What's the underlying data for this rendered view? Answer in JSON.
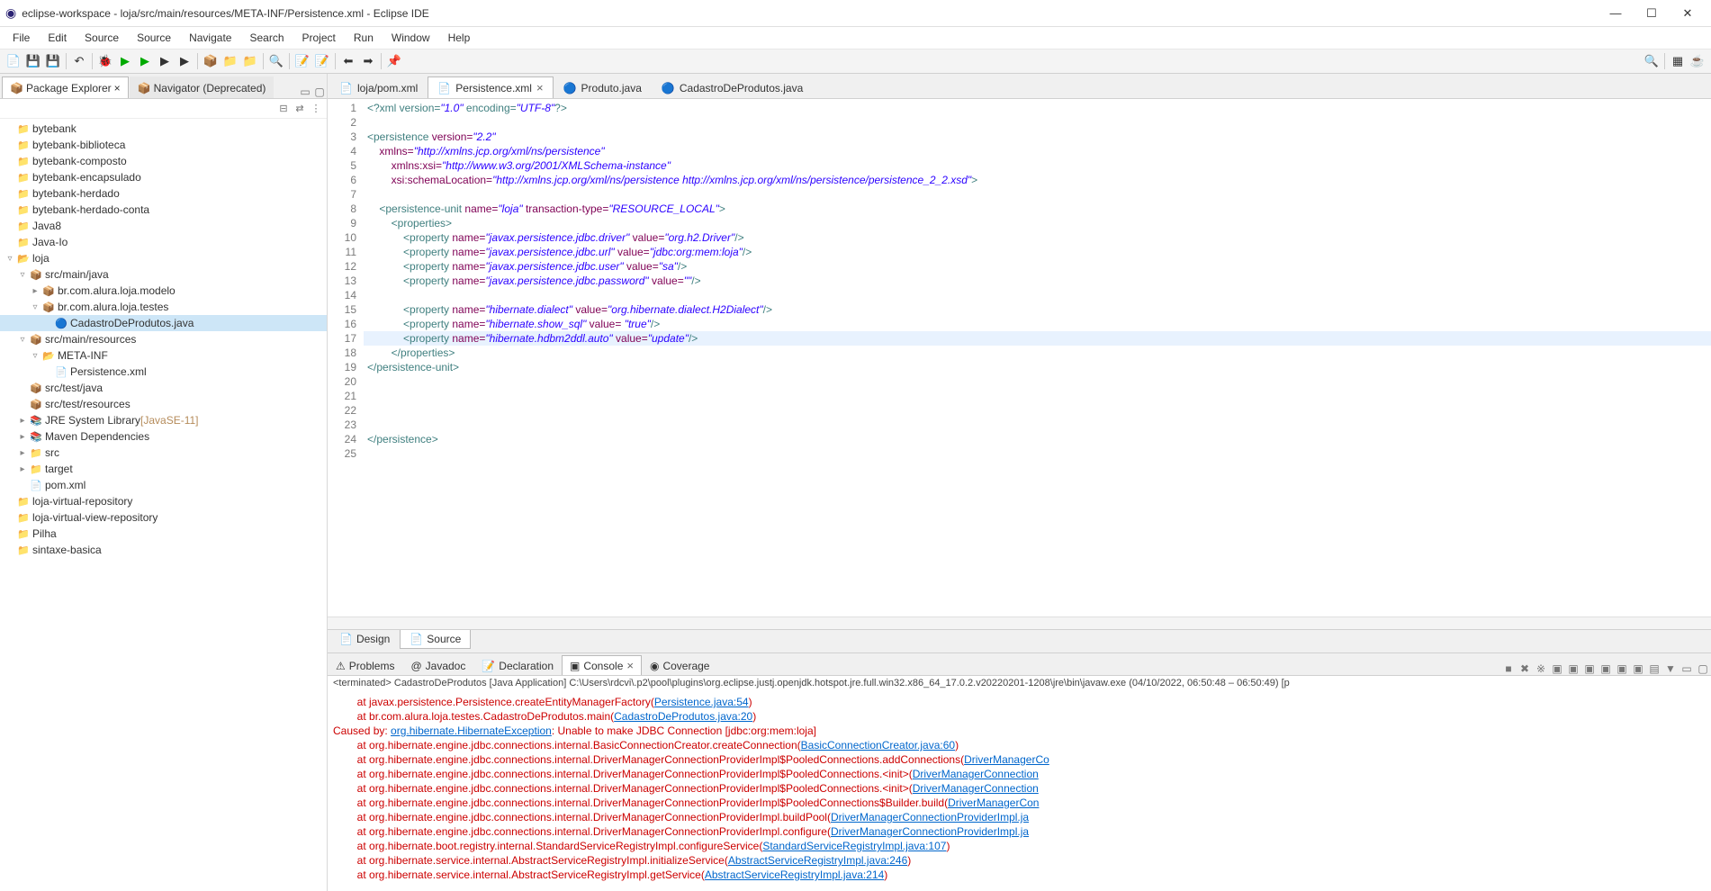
{
  "window_title": "eclipse-workspace - loja/src/main/resources/META-INF/Persistence.xml - Eclipse IDE",
  "menus": [
    "File",
    "Edit",
    "Source",
    "Source",
    "Navigate",
    "Search",
    "Project",
    "Run",
    "Window",
    "Help"
  ],
  "left_panel": {
    "tabs": [
      {
        "label": "Package Explorer",
        "active": true
      },
      {
        "label": "Navigator (Deprecated)",
        "active": false
      }
    ]
  },
  "projects": [
    {
      "label": "bytebank",
      "icon": "📁",
      "lv": 0,
      "tw": ""
    },
    {
      "label": "bytebank-biblioteca",
      "icon": "📁",
      "lv": 0,
      "tw": ""
    },
    {
      "label": "bytebank-composto",
      "icon": "📁",
      "lv": 0,
      "tw": ""
    },
    {
      "label": "bytebank-encapsulado",
      "icon": "📁",
      "lv": 0,
      "tw": ""
    },
    {
      "label": "bytebank-herdado",
      "icon": "📁",
      "lv": 0,
      "tw": ""
    },
    {
      "label": "bytebank-herdado-conta",
      "icon": "📁",
      "lv": 0,
      "tw": ""
    },
    {
      "label": "Java8",
      "icon": "📁",
      "lv": 0,
      "tw": ""
    },
    {
      "label": "Java-Io",
      "icon": "📁",
      "lv": 0,
      "tw": ""
    },
    {
      "label": "loja",
      "icon": "📂",
      "lv": 0,
      "tw": "▿"
    },
    {
      "label": "src/main/java",
      "icon": "📦",
      "lv": 1,
      "tw": "▿"
    },
    {
      "label": "br.com.alura.loja.modelo",
      "icon": "📦",
      "lv": 2,
      "tw": "▸"
    },
    {
      "label": "br.com.alura.loja.testes",
      "icon": "📦",
      "lv": 2,
      "tw": "▿"
    },
    {
      "label": "CadastroDeProdutos.java",
      "icon": "🔵",
      "lv": 3,
      "tw": "",
      "sel": true
    },
    {
      "label": "src/main/resources",
      "icon": "📦",
      "lv": 1,
      "tw": "▿"
    },
    {
      "label": "META-INF",
      "icon": "📂",
      "lv": 2,
      "tw": "▿"
    },
    {
      "label": "Persistence.xml",
      "icon": "📄",
      "lv": 3,
      "tw": ""
    },
    {
      "label": "src/test/java",
      "icon": "📦",
      "lv": 1,
      "tw": ""
    },
    {
      "label": "src/test/resources",
      "icon": "📦",
      "lv": 1,
      "tw": ""
    },
    {
      "label": "JRE System Library",
      "suffix": "[JavaSE-11]",
      "icon": "📚",
      "lv": 1,
      "tw": "▸"
    },
    {
      "label": "Maven Dependencies",
      "icon": "📚",
      "lv": 1,
      "tw": "▸"
    },
    {
      "label": "src",
      "icon": "📁",
      "lv": 1,
      "tw": "▸"
    },
    {
      "label": "target",
      "icon": "📁",
      "lv": 1,
      "tw": "▸"
    },
    {
      "label": "pom.xml",
      "icon": "📄",
      "lv": 1,
      "tw": ""
    },
    {
      "label": "loja-virtual-repository",
      "icon": "📁",
      "lv": 0,
      "tw": ""
    },
    {
      "label": "loja-virtual-view-repository",
      "icon": "📁",
      "lv": 0,
      "tw": ""
    },
    {
      "label": "Pilha",
      "icon": "📁",
      "lv": 0,
      "tw": ""
    },
    {
      "label": "sintaxe-basica",
      "icon": "📁",
      "lv": 0,
      "tw": ""
    }
  ],
  "editor_tabs": [
    {
      "label": "loja/pom.xml",
      "active": false,
      "icon": "📄"
    },
    {
      "label": "Persistence.xml",
      "active": true,
      "icon": "📄",
      "close": true
    },
    {
      "label": "Produto.java",
      "active": false,
      "icon": "🔵"
    },
    {
      "label": "CadastroDeProdutos.java",
      "active": false,
      "icon": "🔵"
    }
  ],
  "line_nums": [
    "1",
    "2",
    "3",
    "4",
    "5",
    "6",
    "7",
    "8",
    "9",
    "10",
    "11",
    "12",
    "13",
    "14",
    "15",
    "16",
    "17",
    "18",
    "19",
    "20",
    "21",
    "22",
    "23",
    "24",
    "25"
  ],
  "code": {
    "l1_a": "<?xml",
    "l1_b": " version=",
    "l1_c": "\"1.0\"",
    "l1_d": " encoding=",
    "l1_e": "\"UTF-8\"",
    "l1_f": "?>",
    "l3_a": "<persistence",
    "l3_b": " version=",
    "l3_c": "\"2.2\"",
    "l4_a": "    xmlns=",
    "l4_b": "\"http://xmlns.jcp.org/xml/ns/persistence\"",
    "l5_a": "        xmlns:xsi=",
    "l5_b": "\"http://www.w3.org/2001/XMLSchema-instance\"",
    "l6_a": "        xsi:schemaLocation=",
    "l6_b": "\"http://xmlns.jcp.org/xml/ns/persistence http://xmlns.jcp.org/xml/ns/persistence/persistence_2_2.xsd\"",
    "l6_c": ">",
    "l8_a": "    <persistence-unit",
    "l8_b": " name=",
    "l8_c": "\"loja\"",
    "l8_d": " transaction-type=",
    "l8_e": "\"RESOURCE_LOCAL\"",
    "l8_f": ">",
    "l9": "        <properties>",
    "l10_a": "            <property",
    "l10_b": " name=",
    "l10_c": "\"javax.persistence.jdbc.driver\"",
    "l10_d": " value=",
    "l10_e": "\"org.h2.Driver\"",
    "l10_f": "/>",
    "l11_a": "            <property",
    "l11_b": " name=",
    "l11_c": "\"javax.persistence.jdbc.url\"",
    "l11_d": " value=",
    "l11_e": "\"jdbc:org:mem:loja\"",
    "l11_f": "/>",
    "l12_a": "            <property",
    "l12_b": " name=",
    "l12_c": "\"javax.persistence.jdbc.user\"",
    "l12_d": " value=",
    "l12_e": "\"sa\"",
    "l12_f": "/>",
    "l13_a": "            <property",
    "l13_b": " name=",
    "l13_c": "\"javax.persistence.jdbc.password\"",
    "l13_d": " value=",
    "l13_e": "\"\"",
    "l13_f": "/>",
    "l15_a": "            <property",
    "l15_b": " name=",
    "l15_c": "\"hibernate.dialect\"",
    "l15_d": " value=",
    "l15_e": "\"org.hibernate.dialect.H2Dialect\"",
    "l15_f": "/>",
    "l16_a": "            <property",
    "l16_b": " name=",
    "l16_c": "\"hibernate.show_sql\"",
    "l16_d": " value= ",
    "l16_e": "\"true\"",
    "l16_f": "/>",
    "l17_a": "            <property",
    "l17_b": " name=",
    "l17_c": "\"hibernate.hdbm2ddl.auto\"",
    "l17_d": " value=",
    "l17_e": "\"update\"",
    "l17_f": "/>",
    "l18": "        </properties>",
    "l19": "</persistence-unit>",
    "l24": "</persistence>"
  },
  "source_sub_tabs": [
    {
      "label": "Design",
      "active": false
    },
    {
      "label": "Source",
      "active": true
    }
  ],
  "bottom_tabs": [
    {
      "label": "Problems",
      "icon": "⚠"
    },
    {
      "label": "Javadoc",
      "icon": "@"
    },
    {
      "label": "Declaration",
      "icon": "📝"
    },
    {
      "label": "Console",
      "icon": "▣",
      "active": true,
      "close": true
    },
    {
      "label": "Coverage",
      "icon": "◉"
    }
  ],
  "term_line": "<terminated> CadastroDeProdutos [Java Application] C:\\Users\\rdcvi\\.p2\\pool\\plugins\\org.eclipse.justj.openjdk.hotspot.jre.full.win32.x86_64_17.0.2.v20220201-1208\\jre\\bin\\javaw.exe  (04/10/2022, 06:50:48 – 06:50:49) [p",
  "console": [
    {
      "t": "        at javax.persistence.Persistence.createEntityManagerFactory(",
      "l": "Persistence.java:54",
      "s": ")"
    },
    {
      "t": "        at br.com.alura.loja.testes.CadastroDeProdutos.main(",
      "l": "CadastroDeProdutos.java:20",
      "s": ")"
    },
    {
      "cb": "Caused by: ",
      "cl": "org.hibernate.HibernateException",
      "ct": ": Unable to make JDBC Connection [jdbc:org:mem:loja]"
    },
    {
      "t": "        at org.hibernate.engine.jdbc.connections.internal.BasicConnectionCreator.createConnection(",
      "l": "BasicConnectionCreator.java:60",
      "s": ")"
    },
    {
      "t": "        at org.hibernate.engine.jdbc.connections.internal.DriverManagerConnectionProviderImpl$PooledConnections.addConnections(",
      "l": "DriverManagerCo",
      "s": ""
    },
    {
      "t": "        at org.hibernate.engine.jdbc.connections.internal.DriverManagerConnectionProviderImpl$PooledConnections.<init>(",
      "l": "DriverManagerConnection",
      "s": ""
    },
    {
      "t": "        at org.hibernate.engine.jdbc.connections.internal.DriverManagerConnectionProviderImpl$PooledConnections.<init>(",
      "l": "DriverManagerConnection",
      "s": ""
    },
    {
      "t": "        at org.hibernate.engine.jdbc.connections.internal.DriverManagerConnectionProviderImpl$PooledConnections$Builder.build(",
      "l": "DriverManagerCon",
      "s": ""
    },
    {
      "t": "        at org.hibernate.engine.jdbc.connections.internal.DriverManagerConnectionProviderImpl.buildPool(",
      "l": "DriverManagerConnectionProviderImpl.ja",
      "s": ""
    },
    {
      "t": "        at org.hibernate.engine.jdbc.connections.internal.DriverManagerConnectionProviderImpl.configure(",
      "l": "DriverManagerConnectionProviderImpl.ja",
      "s": ""
    },
    {
      "t": "        at org.hibernate.boot.registry.internal.StandardServiceRegistryImpl.configureService(",
      "l": "StandardServiceRegistryImpl.java:107",
      "s": ")"
    },
    {
      "t": "        at org.hibernate.service.internal.AbstractServiceRegistryImpl.initializeService(",
      "l": "AbstractServiceRegistryImpl.java:246",
      "s": ")"
    },
    {
      "t": "        at org.hibernate.service.internal.AbstractServiceRegistryImpl.getService(",
      "l": "AbstractServiceRegistryImpl.java:214",
      "s": ")"
    }
  ]
}
